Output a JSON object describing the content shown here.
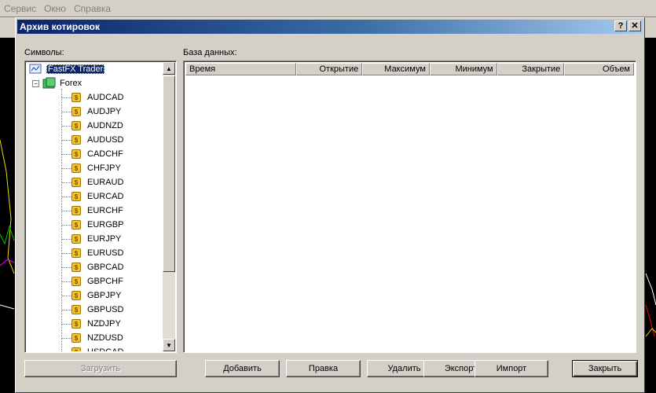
{
  "background_menu": [
    "Сервис",
    "Окно",
    "Справка"
  ],
  "dialog": {
    "title": "Архив котировок",
    "help_glyph": "?",
    "close_glyph": "✕"
  },
  "symbols_label": "Символы:",
  "database_label": "База данных:",
  "tree": {
    "root": "FastFX Trader",
    "group": "Forex",
    "coin_glyph": "$",
    "expander": "−",
    "items": [
      "AUDCAD",
      "AUDJPY",
      "AUDNZD",
      "AUDUSD",
      "CADCHF",
      "CHFJPY",
      "EURAUD",
      "EURCAD",
      "EURCHF",
      "EURGBP",
      "EURJPY",
      "EURUSD",
      "GBPCAD",
      "GBPCHF",
      "GBPJPY",
      "GBPUSD",
      "NZDJPY",
      "NZDUSD",
      "USDCAD"
    ]
  },
  "grid": {
    "columns": [
      "Время",
      "Открытие",
      "Максимум",
      "Минимум",
      "Закрытие",
      "Объем"
    ]
  },
  "buttons": {
    "load": "Загрузить",
    "add": "Добавить",
    "edit": "Правка",
    "delete": "Удалить",
    "export": "Экспорт",
    "import": "Импорт",
    "close": "Закрыть"
  }
}
